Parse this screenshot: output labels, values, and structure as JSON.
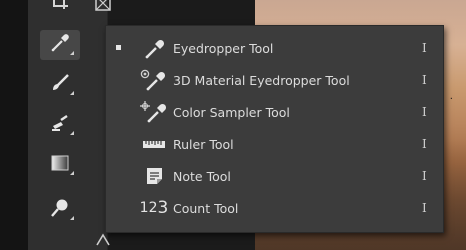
{
  "toolbar": {
    "tools": [
      {
        "name": "crop-frame-tool",
        "icon": "crop-icon"
      },
      {
        "name": "eyedropper-tool",
        "icon": "eyedropper-icon",
        "active": true
      },
      {
        "name": "brush-tool",
        "icon": "brush-icon"
      },
      {
        "name": "clone-stamp-tool",
        "icon": "clone-stamp-icon"
      },
      {
        "name": "gradient-tool",
        "icon": "gradient-icon"
      },
      {
        "name": "dodge-tool",
        "icon": "dodge-icon"
      }
    ]
  },
  "flyout_menu": {
    "items": [
      {
        "label": "Eyedropper Tool",
        "shortcut": "I",
        "icon": "eyedropper-icon",
        "selected": true
      },
      {
        "label": "3D Material Eyedropper Tool",
        "shortcut": "I",
        "icon": "3d-material-eyedropper-icon",
        "selected": false
      },
      {
        "label": "Color Sampler Tool",
        "shortcut": "I",
        "icon": "color-sampler-icon",
        "selected": false
      },
      {
        "label": "Ruler Tool",
        "shortcut": "I",
        "icon": "ruler-icon",
        "selected": false
      },
      {
        "label": "Note Tool",
        "shortcut": "I",
        "icon": "note-icon",
        "selected": false
      },
      {
        "label": "Count Tool",
        "shortcut": "I",
        "icon": "count-icon",
        "selected": false
      }
    ],
    "count_icon_glyphs": {
      "a": "1",
      "b": "2",
      "c": "3"
    }
  },
  "colors": {
    "toolbar_bg": "#2f2f2f",
    "menu_bg": "#3c3c3c",
    "text": "#dcdcdc"
  }
}
